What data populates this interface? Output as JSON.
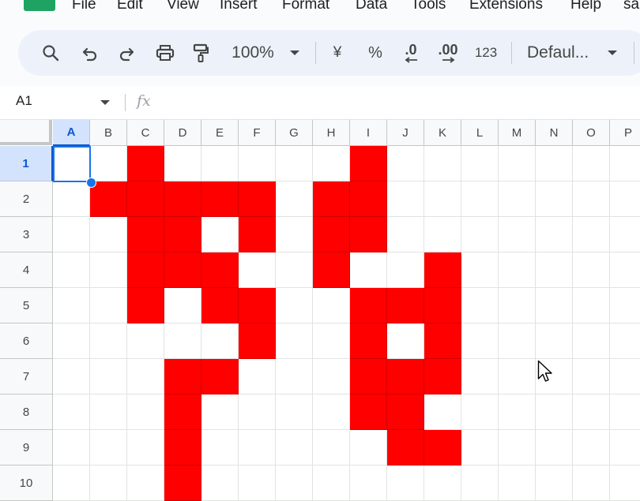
{
  "menu": [
    "File",
    "Edit",
    "View",
    "Insert",
    "Format",
    "Data",
    "Tools",
    "Extensions",
    "Help",
    "sa"
  ],
  "toolbar": {
    "zoom": "100%",
    "currency": "¥",
    "percent": "%",
    "decrease_decimal": ".0",
    "increase_decimal": ".00",
    "number_format": "123",
    "font": "Defaul..."
  },
  "formula_bar": {
    "name_box": "A1",
    "fx": "fx"
  },
  "columns": [
    "A",
    "B",
    "C",
    "D",
    "E",
    "F",
    "G",
    "H",
    "I",
    "J",
    "K",
    "L",
    "M",
    "N",
    "O",
    "P"
  ],
  "rows": [
    "1",
    "2",
    "3",
    "4",
    "5",
    "6",
    "7",
    "8",
    "9",
    "10"
  ],
  "selected_cell": "A1",
  "fill_color": "#ff0000",
  "filled_cells": [
    "C1",
    "I1",
    "B2",
    "C2",
    "D2",
    "E2",
    "F2",
    "H2",
    "I2",
    "C3",
    "D3",
    "F3",
    "H3",
    "I3",
    "C4",
    "D4",
    "E4",
    "H4",
    "K4",
    "C5",
    "E5",
    "F5",
    "I5",
    "J5",
    "K5",
    "F6",
    "I6",
    "K6",
    "D7",
    "E7",
    "I7",
    "J7",
    "K7",
    "D8",
    "I8",
    "J8",
    "D9",
    "J9",
    "K9",
    "D10"
  ],
  "icons": {
    "search": "search-icon",
    "undo": "undo-icon",
    "redo": "redo-icon",
    "print": "print-icon",
    "paint_format": "paint-format-icon",
    "cursor": "mouse-pointer-icon"
  }
}
